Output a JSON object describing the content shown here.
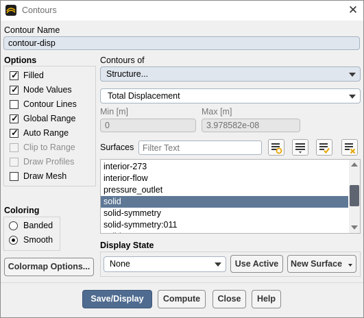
{
  "window": {
    "title": "Contours",
    "close_glyph": "✕"
  },
  "contour_name": {
    "label": "Contour Name",
    "value": "contour-disp"
  },
  "options": {
    "label": "Options",
    "items": [
      {
        "label": "Filled",
        "checked": true,
        "enabled": true
      },
      {
        "label": "Node Values",
        "checked": true,
        "enabled": true
      },
      {
        "label": "Contour Lines",
        "checked": false,
        "enabled": true
      },
      {
        "label": "Global Range",
        "checked": true,
        "enabled": true
      },
      {
        "label": "Auto Range",
        "checked": true,
        "enabled": true
      },
      {
        "label": "Clip to Range",
        "checked": false,
        "enabled": false
      },
      {
        "label": "Draw Profiles",
        "checked": false,
        "enabled": false
      },
      {
        "label": "Draw Mesh",
        "checked": false,
        "enabled": true
      }
    ],
    "check_glyph": "✓"
  },
  "coloring": {
    "label": "Coloring",
    "items": [
      {
        "label": "Banded",
        "selected": false
      },
      {
        "label": "Smooth",
        "selected": true
      }
    ]
  },
  "colormap_button": "Colormap Options...",
  "contours_of": {
    "label": "Contours of",
    "category": "Structure...",
    "quantity": "Total Displacement"
  },
  "range": {
    "min_label": "Min [m]",
    "min_value": "0",
    "max_label": "Max [m]",
    "max_value": "3.978582e-08"
  },
  "surfaces": {
    "label": "Surfaces",
    "filter_placeholder": "Filter Text",
    "items": [
      {
        "label": "interior-273",
        "selected": false
      },
      {
        "label": "interior-flow",
        "selected": false
      },
      {
        "label": "pressure_outlet",
        "selected": false
      },
      {
        "label": "solid",
        "selected": true
      },
      {
        "label": "solid-symmetry",
        "selected": false
      },
      {
        "label": "solid-symmetry:011",
        "selected": false
      },
      {
        "label": "solid-..",
        "selected": false
      }
    ],
    "toolbar_icons": [
      "select-all-icon",
      "deselect-all-icon",
      "new-group-icon",
      "unselect-icon"
    ]
  },
  "display_state": {
    "label": "Display State",
    "value": "None",
    "use_active": "Use Active",
    "new_surface": "New Surface"
  },
  "footer": {
    "save_display": "Save/Display",
    "compute": "Compute",
    "close": "Close",
    "help": "Help"
  },
  "colors": {
    "accent": "#4f6b8f",
    "selection": "#5f7896",
    "field_bg": "#dfe6ee",
    "logo_yellow": "#f2b600"
  }
}
